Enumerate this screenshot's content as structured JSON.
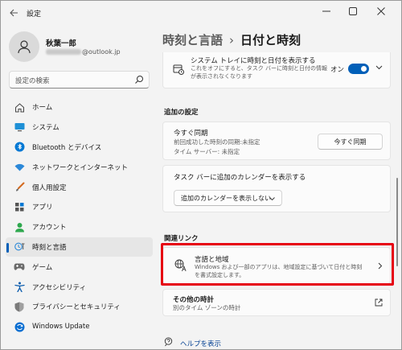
{
  "window": {
    "title": "設定"
  },
  "profile": {
    "name": "秋葉一郎",
    "email_domain": "@outlook.jp"
  },
  "search": {
    "placeholder": "設定の検索"
  },
  "nav": [
    {
      "label": "ホーム",
      "icon": "home-icon"
    },
    {
      "label": "システム",
      "icon": "system-icon"
    },
    {
      "label": "Bluetooth とデバイス",
      "icon": "bluetooth-icon"
    },
    {
      "label": "ネットワークとインターネット",
      "icon": "wifi-icon"
    },
    {
      "label": "個人用設定",
      "icon": "brush-icon"
    },
    {
      "label": "アプリ",
      "icon": "apps-icon"
    },
    {
      "label": "アカウント",
      "icon": "account-icon"
    },
    {
      "label": "時刻と言語",
      "icon": "time-language-icon",
      "active": true
    },
    {
      "label": "ゲーム",
      "icon": "gamepad-icon"
    },
    {
      "label": "アクセシビリティ",
      "icon": "accessibility-icon"
    },
    {
      "label": "プライバシーとセキュリティ",
      "icon": "shield-icon"
    },
    {
      "label": "Windows Update",
      "icon": "update-icon"
    }
  ],
  "breadcrumb": {
    "parent": "時刻と言語",
    "separator": "›",
    "current": "日付と時刻"
  },
  "tray_card": {
    "title": "システム トレイに時刻と日付を表示する",
    "desc": "これをオフにすると、タスク バーに時刻と日付の情報が表示されなくなります",
    "toggle_label": "オン",
    "toggle_on": true
  },
  "additional": {
    "heading": "追加の設定",
    "sync": {
      "title": "今すぐ同期",
      "line1": "前回成功した時刻の同期:未指定",
      "line2": "タイム サーバー: 未指定",
      "button": "今すぐ同期"
    },
    "calendar": {
      "title": "タスク バーに追加のカレンダーを表示する",
      "select": "追加のカレンダーを表示しない"
    }
  },
  "related": {
    "heading": "関連リンク",
    "region": {
      "title": "言語と地域",
      "desc": "Windows および一部のアプリは、地域設定に基づいて日付と時刻を書式設定します。"
    },
    "other_clocks": {
      "title": "その他の時計",
      "desc": "別のタイム ゾーンの時計"
    }
  },
  "help": {
    "label": "ヘルプを表示"
  },
  "colors": {
    "accent": "#005fb8",
    "highlight": "#e60012"
  }
}
